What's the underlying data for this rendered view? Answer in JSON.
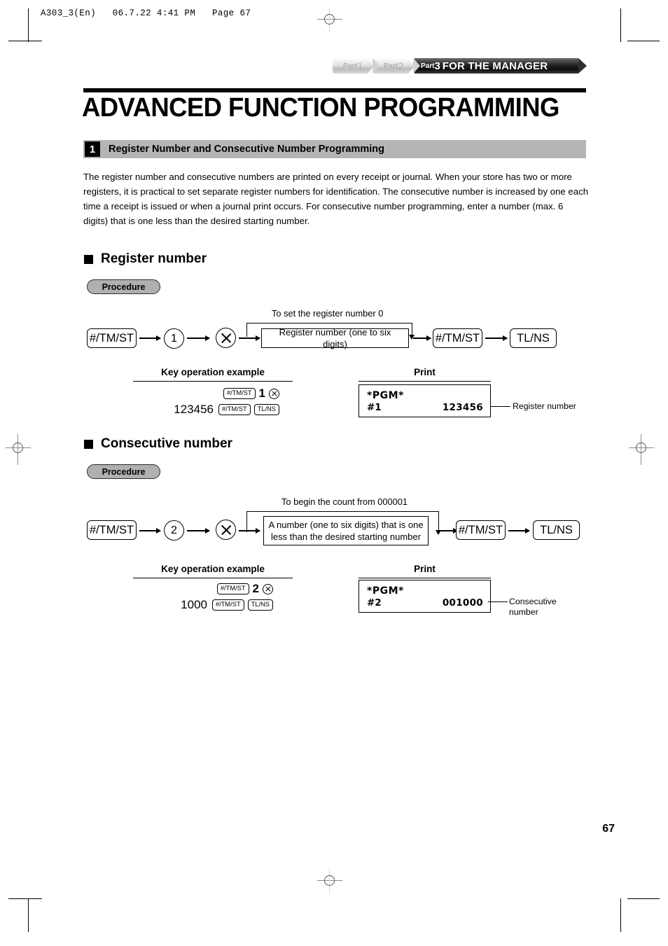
{
  "print_header": "A303_3(En)   06.7.22 4:41 PM   Page 67",
  "part_banner": {
    "part1_label": "Part",
    "part1_num": "1",
    "part2_label": "Part",
    "part2_num": "2",
    "part3_label": "Part",
    "part3_num": "3",
    "title": "FOR THE MANAGER"
  },
  "page_title": "ADVANCED FUNCTION PROGRAMMING",
  "section": {
    "number": "1",
    "title": "Register Number and Consecutive Number Programming"
  },
  "intro_text": "The register number and consecutive numbers are printed on every receipt or journal. When your store has two or more registers, it is practical to set separate register numbers for identification.  The consecutive number is increased by one each time a receipt is issued or when a journal print occurs. For consecutive number programming, enter a number (max. 6 digits) that is one less than the desired starting number.",
  "register_number": {
    "heading": "Register number",
    "procedure_label": "Procedure",
    "flow": {
      "key1": "#/TM/ST",
      "mode": "1",
      "multiply": "multiply-icon",
      "entry_box": "Register number (one to six digits)",
      "key2": "#/TM/ST",
      "key3": "TL/NS",
      "bypass_label": "To set the register number  0"
    },
    "example_heading": "Key operation example",
    "print_heading": "Print",
    "example": {
      "row1_key": "#/TM/ST",
      "row1_digit": "1",
      "row1_multiply": "multiply-icon",
      "row2_value": "123456",
      "row2_key1": "#/TM/ST",
      "row2_key2": "TL/NS"
    },
    "print": {
      "pgm": "*PGM*",
      "label": "#1",
      "value": "123456",
      "annotation": "Register number"
    }
  },
  "consecutive_number": {
    "heading": "Consecutive number",
    "procedure_label": "Procedure",
    "flow": {
      "key1": "#/TM/ST",
      "mode": "2",
      "multiply": "multiply-icon",
      "entry_box": "A number (one to six digits) that is one less than the desired starting number",
      "key2": "#/TM/ST",
      "key3": "TL/NS",
      "bypass_label": "To begin the count from 000001"
    },
    "example_heading": "Key operation example",
    "print_heading": "Print",
    "example": {
      "row1_key": "#/TM/ST",
      "row1_digit": "2",
      "row1_multiply": "multiply-icon",
      "row2_value": "1000",
      "row2_key1": "#/TM/ST",
      "row2_key2": "TL/NS"
    },
    "print": {
      "pgm": "*PGM*",
      "label": "#2",
      "value": "001000",
      "annotation_line1": "Consecutive",
      "annotation_line2": "number"
    }
  },
  "page_number": "67"
}
